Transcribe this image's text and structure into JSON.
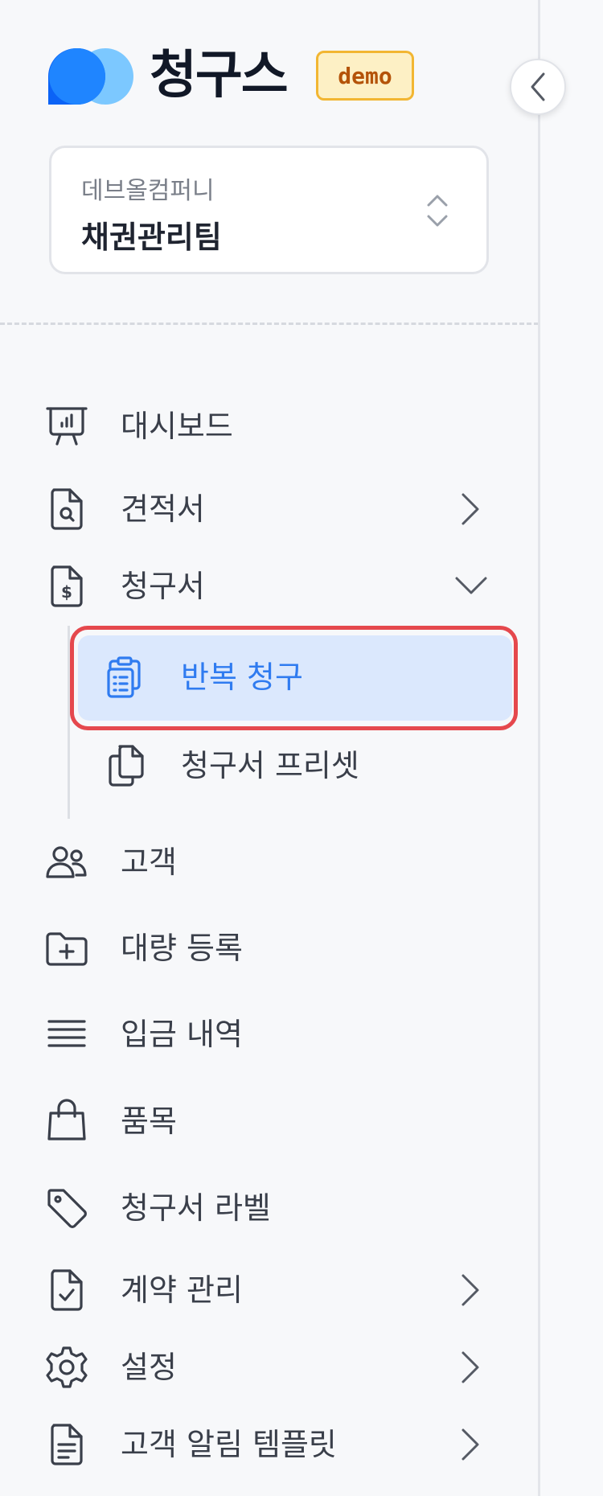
{
  "brand": {
    "name": "청구스",
    "badge": "demo"
  },
  "org": {
    "company": "데브올컴퍼니",
    "team": "채권관리팀"
  },
  "nav": {
    "dashboard": "대시보드",
    "quotes": "견적서",
    "invoices": "청구서",
    "recurring": "반복 청구",
    "presets": "청구서 프리셋",
    "customers": "고객",
    "bulk": "대량 등록",
    "deposits": "입금 내역",
    "items": "품목",
    "labels": "청구서 라벨",
    "contracts": "계약 관리",
    "settings": "설정",
    "templates": "고객 알림 템플릿"
  },
  "colors": {
    "accent": "#2f7bf0",
    "active_bg": "#dbe8fd",
    "highlight": "#e5484d",
    "badge_bg": "#fdf0c5"
  }
}
